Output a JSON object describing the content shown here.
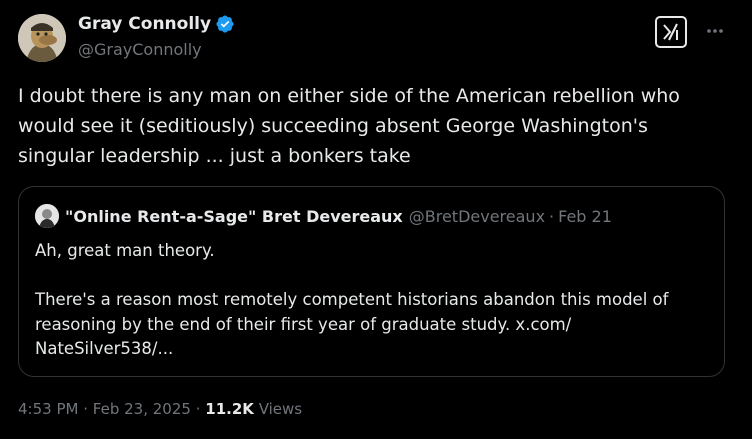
{
  "author": {
    "display_name": "Gray Connolly",
    "handle": "@GrayConnolly",
    "verified_icon": "verified-badge-icon",
    "verified_color": "#1d9bf0"
  },
  "tweet": {
    "text_lines": [
      "I doubt there is any man on either side of the American rebellion who",
      "would see it (seditiously) succeeding absent George Washington's",
      "singular leadership ... just a bonkers take"
    ],
    "time": "4:53 PM",
    "separator": "·",
    "date": "Feb 23, 2025",
    "views_count": "11.2K",
    "views_label": "Views"
  },
  "quote": {
    "display_name": "\"Online Rent-a-Sage\" Bret Devereaux",
    "handle": "@BretDevereaux",
    "separator": "·",
    "date": "Feb 21",
    "text_lines": [
      "Ah, great man theory.",
      "",
      "There's a reason most remotely competent historians abandon this model of",
      "reasoning by the end of their first year of graduate study. x.com/",
      "NateSilver538/..."
    ]
  },
  "actions": {
    "grok_icon": "grok-icon",
    "more_icon": "more-options-icon"
  },
  "colors": {
    "background": "#000000",
    "text_primary": "#e7e9ea",
    "text_secondary": "#71767b",
    "border": "#2f3336"
  }
}
